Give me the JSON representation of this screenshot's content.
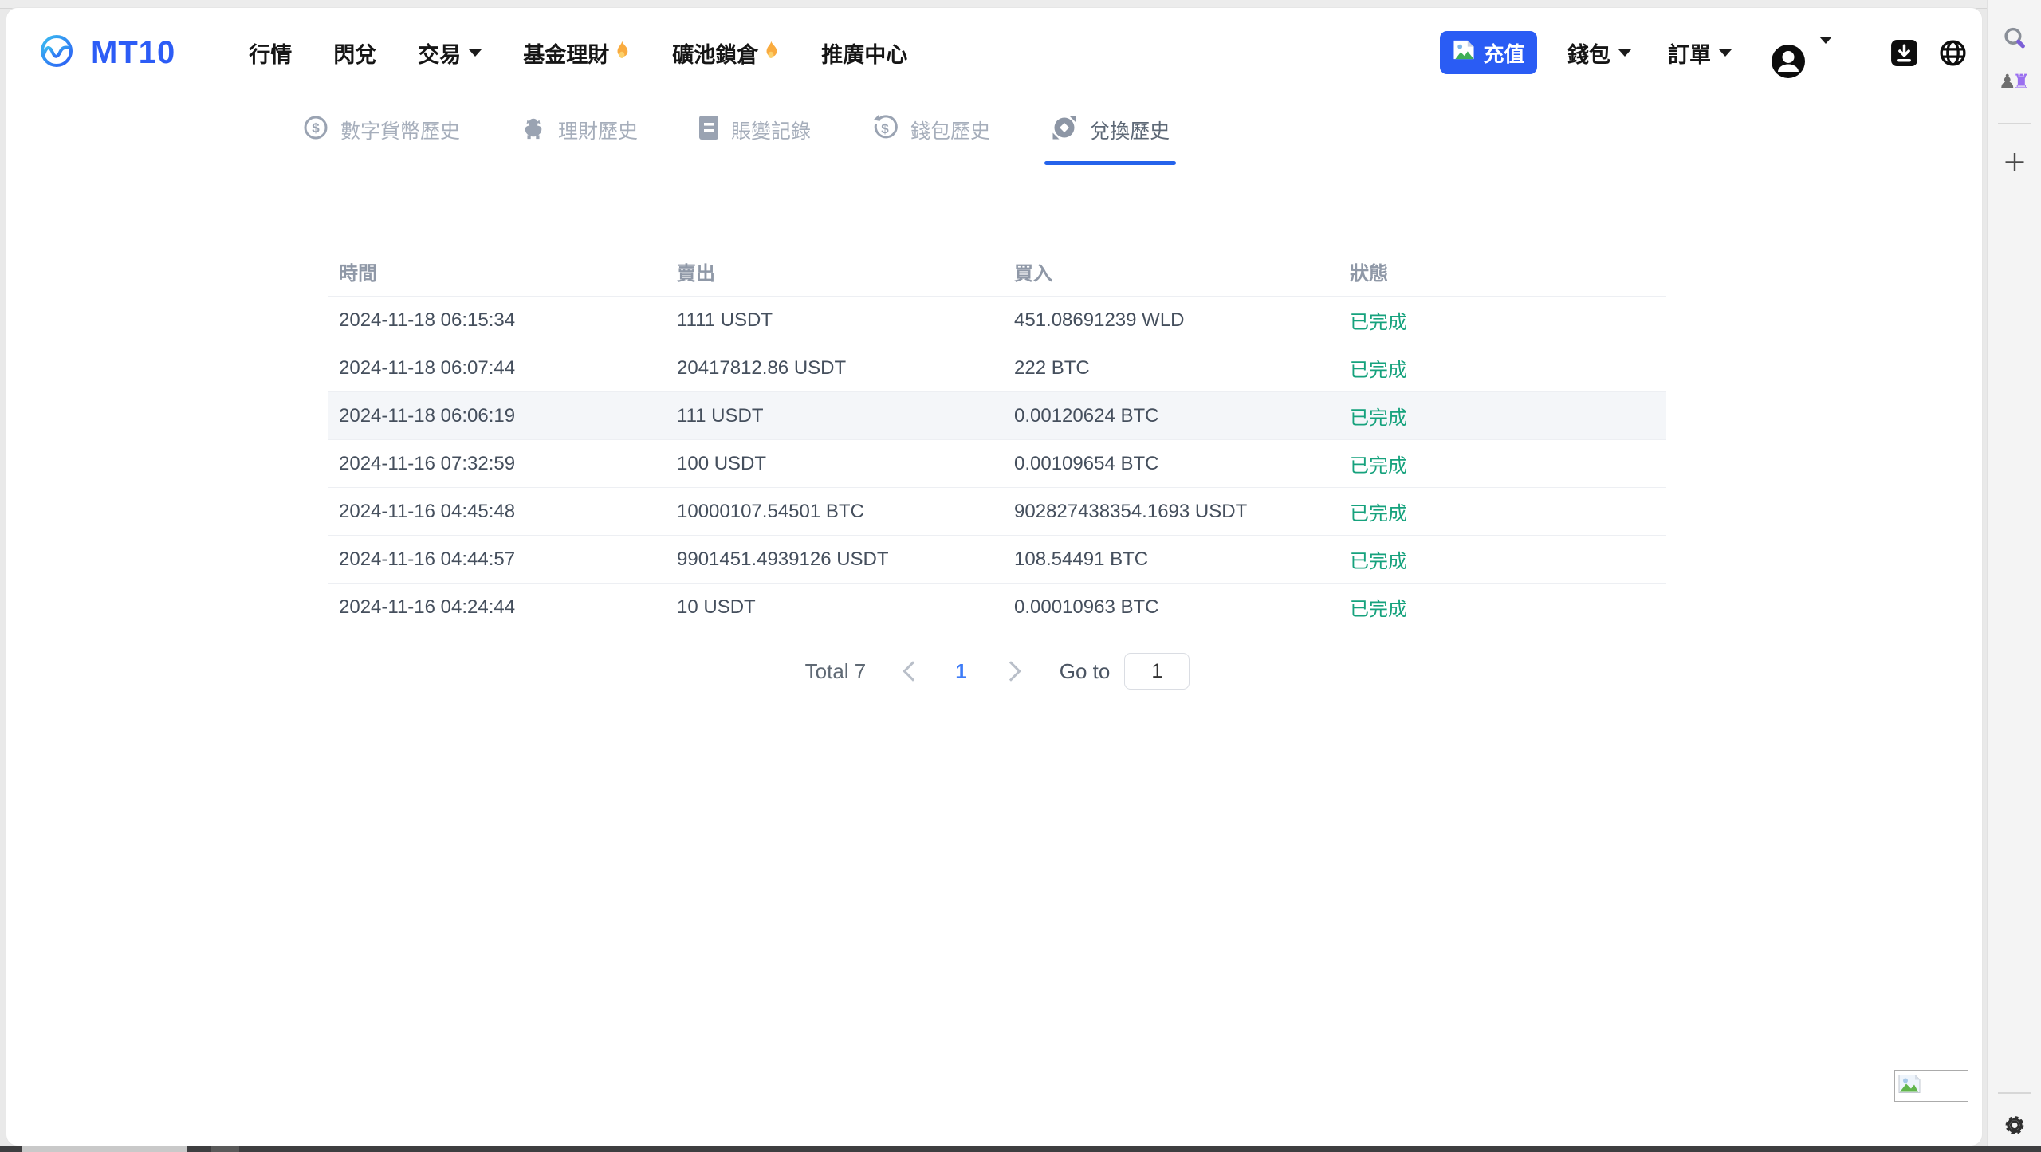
{
  "brand": {
    "name": "MT10"
  },
  "nav": {
    "items": [
      {
        "label": "行情"
      },
      {
        "label": "閃兌"
      },
      {
        "label": "交易",
        "dropdown": true
      },
      {
        "label": "基金理財",
        "hot": true
      },
      {
        "label": "礦池鎖倉",
        "hot": true
      },
      {
        "label": "推廣中心"
      }
    ]
  },
  "actions": {
    "deposit_label": "充值",
    "wallet_label": "錢包",
    "orders_label": "訂單"
  },
  "tabs": [
    {
      "label": "數字貨幣歷史",
      "icon": "dollar-circle",
      "active": false
    },
    {
      "label": "理財歷史",
      "icon": "piggy-bank",
      "active": false
    },
    {
      "label": "賬變記錄",
      "icon": "ledger",
      "active": false
    },
    {
      "label": "錢包歷史",
      "icon": "wallet-history",
      "active": false
    },
    {
      "label": "兌換歷史",
      "icon": "swap-circle",
      "active": true
    }
  ],
  "table": {
    "headers": [
      "時間",
      "賣出",
      "買入",
      "狀態"
    ],
    "rows": [
      {
        "time": "2024-11-18 06:15:34",
        "sell": "1111 USDT",
        "buy": "451.08691239 WLD",
        "status": "已完成"
      },
      {
        "time": "2024-11-18 06:07:44",
        "sell": "20417812.86 USDT",
        "buy": "222 BTC",
        "status": "已完成"
      },
      {
        "time": "2024-11-18 06:06:19",
        "sell": "111 USDT",
        "buy": "0.00120624 BTC",
        "status": "已完成"
      },
      {
        "time": "2024-11-16 07:32:59",
        "sell": "100 USDT",
        "buy": "0.00109654 BTC",
        "status": "已完成"
      },
      {
        "time": "2024-11-16 04:45:48",
        "sell": "10000107.54501 BTC",
        "buy": "902827438354.1693 USDT",
        "status": "已完成"
      },
      {
        "time": "2024-11-16 04:44:57",
        "sell": "9901451.4939126 USDT",
        "buy": "108.54491 BTC",
        "status": "已完成"
      },
      {
        "time": "2024-11-16 04:24:44",
        "sell": "10 USDT",
        "buy": "0.00010963 BTC",
        "status": "已完成"
      }
    ],
    "highlighted_row_index": 2
  },
  "pagination": {
    "total_label": "Total 7",
    "current_page": "1",
    "goto_label": "Go to",
    "goto_value": "1"
  },
  "browser": {
    "extension_pawn": "♟",
    "extension_rook": "♜"
  },
  "icons": {
    "brand": "wave-logo",
    "deposit": "image-placeholder",
    "nav_hot": "flame",
    "account": "person-circle",
    "download": "download-arrow",
    "language": "globe",
    "sidebar_search": "magnifier",
    "sidebar_extension": "chess-pieces",
    "sidebar_new": "plus",
    "sidebar_settings": "gear",
    "bottom_left_box": "broken-image"
  },
  "colors": {
    "accent_blue": "#2a5cf4",
    "tab_underline": "#2563eb",
    "success_green": "#16a27d",
    "page_link_blue": "#3d7bf7"
  }
}
